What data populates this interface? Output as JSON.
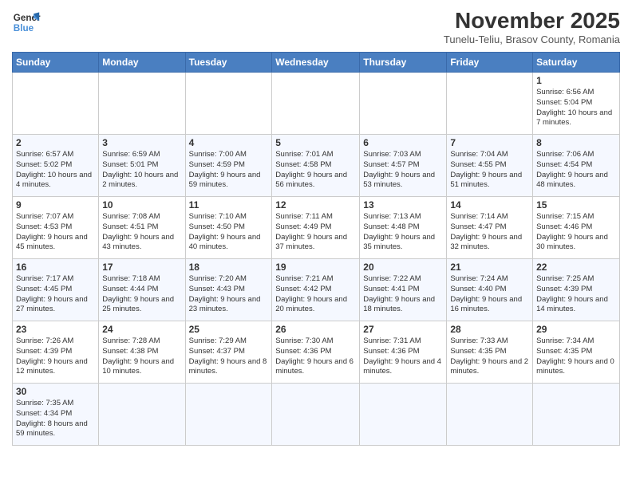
{
  "logo": {
    "line1": "General",
    "line2": "Blue"
  },
  "title": "November 2025",
  "subtitle": "Tunelu-Teliu, Brasov County, Romania",
  "weekdays": [
    "Sunday",
    "Monday",
    "Tuesday",
    "Wednesday",
    "Thursday",
    "Friday",
    "Saturday"
  ],
  "weeks": [
    [
      {
        "day": "",
        "info": ""
      },
      {
        "day": "",
        "info": ""
      },
      {
        "day": "",
        "info": ""
      },
      {
        "day": "",
        "info": ""
      },
      {
        "day": "",
        "info": ""
      },
      {
        "day": "",
        "info": ""
      },
      {
        "day": "1",
        "info": "Sunrise: 6:56 AM\nSunset: 5:04 PM\nDaylight: 10 hours and 7 minutes."
      }
    ],
    [
      {
        "day": "2",
        "info": "Sunrise: 6:57 AM\nSunset: 5:02 PM\nDaylight: 10 hours and 4 minutes."
      },
      {
        "day": "3",
        "info": "Sunrise: 6:59 AM\nSunset: 5:01 PM\nDaylight: 10 hours and 2 minutes."
      },
      {
        "day": "4",
        "info": "Sunrise: 7:00 AM\nSunset: 4:59 PM\nDaylight: 9 hours and 59 minutes."
      },
      {
        "day": "5",
        "info": "Sunrise: 7:01 AM\nSunset: 4:58 PM\nDaylight: 9 hours and 56 minutes."
      },
      {
        "day": "6",
        "info": "Sunrise: 7:03 AM\nSunset: 4:57 PM\nDaylight: 9 hours and 53 minutes."
      },
      {
        "day": "7",
        "info": "Sunrise: 7:04 AM\nSunset: 4:55 PM\nDaylight: 9 hours and 51 minutes."
      },
      {
        "day": "8",
        "info": "Sunrise: 7:06 AM\nSunset: 4:54 PM\nDaylight: 9 hours and 48 minutes."
      }
    ],
    [
      {
        "day": "9",
        "info": "Sunrise: 7:07 AM\nSunset: 4:53 PM\nDaylight: 9 hours and 45 minutes."
      },
      {
        "day": "10",
        "info": "Sunrise: 7:08 AM\nSunset: 4:51 PM\nDaylight: 9 hours and 43 minutes."
      },
      {
        "day": "11",
        "info": "Sunrise: 7:10 AM\nSunset: 4:50 PM\nDaylight: 9 hours and 40 minutes."
      },
      {
        "day": "12",
        "info": "Sunrise: 7:11 AM\nSunset: 4:49 PM\nDaylight: 9 hours and 37 minutes."
      },
      {
        "day": "13",
        "info": "Sunrise: 7:13 AM\nSunset: 4:48 PM\nDaylight: 9 hours and 35 minutes."
      },
      {
        "day": "14",
        "info": "Sunrise: 7:14 AM\nSunset: 4:47 PM\nDaylight: 9 hours and 32 minutes."
      },
      {
        "day": "15",
        "info": "Sunrise: 7:15 AM\nSunset: 4:46 PM\nDaylight: 9 hours and 30 minutes."
      }
    ],
    [
      {
        "day": "16",
        "info": "Sunrise: 7:17 AM\nSunset: 4:45 PM\nDaylight: 9 hours and 27 minutes."
      },
      {
        "day": "17",
        "info": "Sunrise: 7:18 AM\nSunset: 4:44 PM\nDaylight: 9 hours and 25 minutes."
      },
      {
        "day": "18",
        "info": "Sunrise: 7:20 AM\nSunset: 4:43 PM\nDaylight: 9 hours and 23 minutes."
      },
      {
        "day": "19",
        "info": "Sunrise: 7:21 AM\nSunset: 4:42 PM\nDaylight: 9 hours and 20 minutes."
      },
      {
        "day": "20",
        "info": "Sunrise: 7:22 AM\nSunset: 4:41 PM\nDaylight: 9 hours and 18 minutes."
      },
      {
        "day": "21",
        "info": "Sunrise: 7:24 AM\nSunset: 4:40 PM\nDaylight: 9 hours and 16 minutes."
      },
      {
        "day": "22",
        "info": "Sunrise: 7:25 AM\nSunset: 4:39 PM\nDaylight: 9 hours and 14 minutes."
      }
    ],
    [
      {
        "day": "23",
        "info": "Sunrise: 7:26 AM\nSunset: 4:39 PM\nDaylight: 9 hours and 12 minutes."
      },
      {
        "day": "24",
        "info": "Sunrise: 7:28 AM\nSunset: 4:38 PM\nDaylight: 9 hours and 10 minutes."
      },
      {
        "day": "25",
        "info": "Sunrise: 7:29 AM\nSunset: 4:37 PM\nDaylight: 9 hours and 8 minutes."
      },
      {
        "day": "26",
        "info": "Sunrise: 7:30 AM\nSunset: 4:36 PM\nDaylight: 9 hours and 6 minutes."
      },
      {
        "day": "27",
        "info": "Sunrise: 7:31 AM\nSunset: 4:36 PM\nDaylight: 9 hours and 4 minutes."
      },
      {
        "day": "28",
        "info": "Sunrise: 7:33 AM\nSunset: 4:35 PM\nDaylight: 9 hours and 2 minutes."
      },
      {
        "day": "29",
        "info": "Sunrise: 7:34 AM\nSunset: 4:35 PM\nDaylight: 9 hours and 0 minutes."
      }
    ],
    [
      {
        "day": "30",
        "info": "Sunrise: 7:35 AM\nSunset: 4:34 PM\nDaylight: 8 hours and 59 minutes."
      },
      {
        "day": "",
        "info": ""
      },
      {
        "day": "",
        "info": ""
      },
      {
        "day": "",
        "info": ""
      },
      {
        "day": "",
        "info": ""
      },
      {
        "day": "",
        "info": ""
      },
      {
        "day": "",
        "info": ""
      }
    ]
  ]
}
